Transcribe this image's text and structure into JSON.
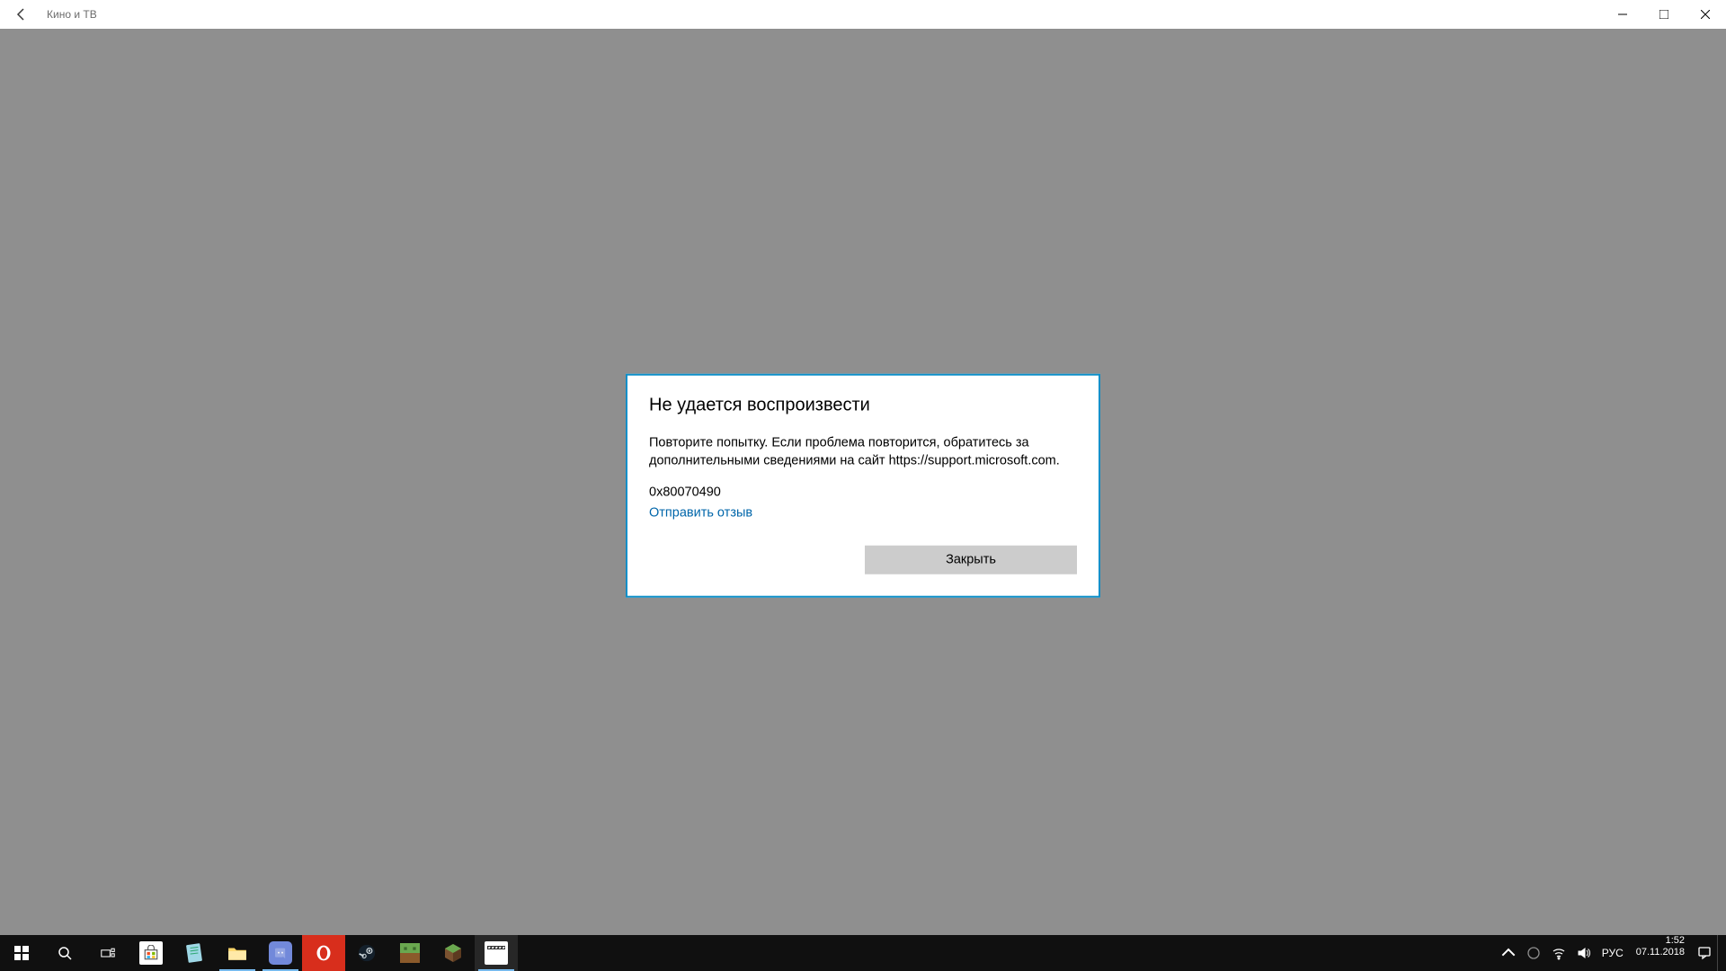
{
  "app": {
    "title": "Кино и ТВ"
  },
  "dialog": {
    "title": "Не удается воспроизвести",
    "message": "Повторите попытку. Если проблема повторится, обратитесь за дополнительными сведениями на сайт https://support.microsoft.com.",
    "error_code": "0x80070490",
    "feedback_link": "Отправить отзыв",
    "close_button": "Закрыть"
  },
  "taskbar": {
    "apps": [
      {
        "name": "microsoft-store"
      },
      {
        "name": "notepad"
      },
      {
        "name": "file-explorer"
      },
      {
        "name": "discord"
      },
      {
        "name": "opera"
      },
      {
        "name": "steam"
      },
      {
        "name": "minecraft"
      },
      {
        "name": "minecraft-launcher"
      },
      {
        "name": "movies-tv"
      }
    ]
  },
  "tray": {
    "input_language": "РУС",
    "time": "1:52",
    "date": "07.11.2018"
  }
}
